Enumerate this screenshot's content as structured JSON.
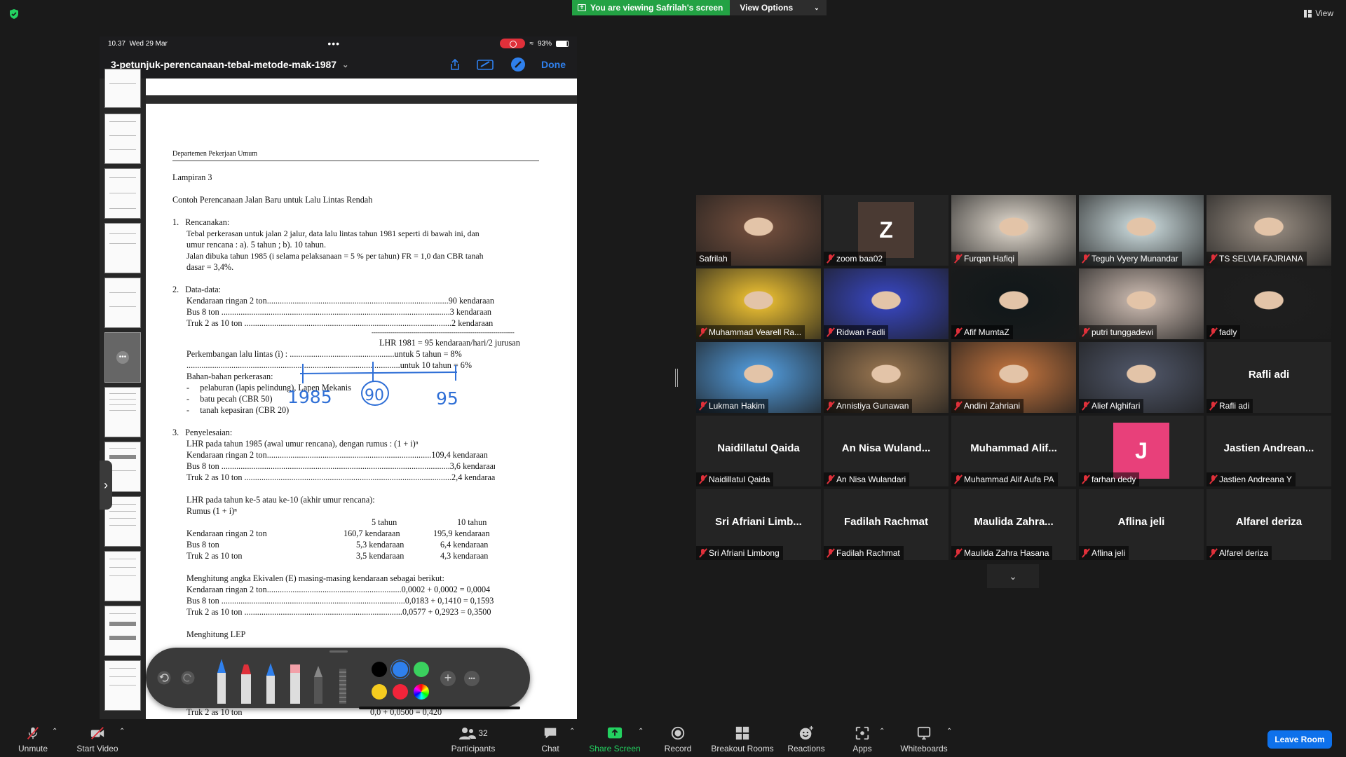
{
  "banner": {
    "share_text": "You are viewing Safrilah's screen",
    "view_options": "View Options"
  },
  "top_right": {
    "view_label": "View"
  },
  "ipad": {
    "time": "10.37",
    "date": "Wed 29 Mar",
    "battery": "93%",
    "doc_title": "3-petunjuk-perencanaan-tebal-metode-mak-1987",
    "done_label": "Done"
  },
  "document": {
    "header": "Departemen Pekerjaan Umum",
    "lines": [
      "Lampiran 3",
      "Contoh Perencanaan Jalan Baru untuk Lalu Lintas Rendah",
      "1.   Rencanakan:",
      "Tebal perkerasan untuk jalan 2 jalur, data lalu lintas tahun 1981 seperti di bawah ini, dan",
      "umur rencana : a). 5 tahun ; b). 10 tahun.",
      "Jalan dibuka tahun 1985 (i selama pelaksanaan = 5 % per tahun) FR = 1,0 dan CBR tanah",
      "dasar = 3,4%.",
      "2.   Data-data:",
      "Kendaraan ringan 2 ton.....................................................................................90 kendaraan",
      "Bus 8 ton ...........................................................................................................3 kendaraan",
      "Truk 2 as 10 ton .................................................................................................2 kendaraan",
      "--------------------------------------------------------------------",
      "LHR 1981 = 95 kendaraan/hari/2 jurusan",
      "Perkembangan lalu lintas (i) : .................................................untuk 5 tahun = 8%",
      "....................................................................................................untuk 10 tahun = 6%",
      "Bahan-bahan perkerasan:",
      "-     pelaburan (lapis pelindung), Lapen Mekanis",
      "-     batu pecah (CBR 50)",
      "-     tanah kepasiran (CBR 20)",
      "3.   Penyelesaian:",
      "LHR pada tahun 1985 (awal umur rencana), dengan rumus : (1 + i)ⁿ",
      "Kendaraan ringan 2 ton.............................................................................109,4 kendaraan",
      "Bus 8 ton ...........................................................................................................3,6 kendaraan",
      "Truk 2 as 10 ton .................................................................................................2,4 kendaraan",
      "LHR pada tahun ke-5 atau ke-10 (akhir umur rencana):",
      "Rumus (1 + i)ⁿ",
      "5 tahun",
      "10 tahun",
      "Kendaraan ringan 2 ton",
      "160,7 kendaraan",
      "195,9 kendaraan",
      "Bus 8 ton",
      "5,3 kendaraan",
      "6,4 kendaraan",
      "Truk 2 as 10 ton",
      "3,5 kendaraan",
      "4,3 kendaraan",
      "Menghitung angka Ekivalen (E) masing-masing kendaraan sebagai berikut:",
      "Kendaraan ringan 2 ton...............................................................0,0002 + 0,0002 = 0,0004",
      "Bus 8 ton ......................................................................................0,0183 + 0,1410 = 0,1593",
      "Truk 2 as 10 ton ..........................................................................0,0577 + 0,2923 = 0,3500",
      "Menghitung LEP",
      "Truk 2 as 10 ton",
      "0,0 + 0,0500 = 0,420"
    ],
    "ink_labels": [
      "1985",
      "90",
      "95"
    ]
  },
  "participants": [
    {
      "name": "Safrilah",
      "muted": false,
      "active": true,
      "bg": "#6b4a3a"
    },
    {
      "name": "zoom baa02",
      "muted": true,
      "letter": "Z",
      "letter_bg": "#4a3a33"
    },
    {
      "name": "Furqan Hafiqi",
      "muted": true,
      "bg": "#c9c2b8"
    },
    {
      "name": "Teguh Vyery Munandar",
      "muted": true,
      "bg": "#b9c7c9"
    },
    {
      "name": "TS SELVIA FAJRIANA",
      "muted": true,
      "bg": "#8b8177"
    },
    {
      "name": "Muhammad Vearell Ra...",
      "muted": true,
      "bg": "#d8b030"
    },
    {
      "name": "Ridwan Fadli",
      "muted": true,
      "bg": "#3542b0"
    },
    {
      "name": "Afif MumtaZ",
      "muted": true,
      "bg": "#12181a"
    },
    {
      "name": "putri tunggadewi",
      "muted": true,
      "bg": "#b8a9a0"
    },
    {
      "name": "fadly",
      "muted": true,
      "bg": "#1e1e1e"
    },
    {
      "name": "Lukman Hakim",
      "muted": true,
      "bg": "#4d8fc9"
    },
    {
      "name": "Annistiya Gunawan",
      "muted": true,
      "bg": "#8a6b4a"
    },
    {
      "name": "Andini Zahriani",
      "muted": true,
      "bg": "#b06a3a"
    },
    {
      "name": "Alief Alghifari",
      "muted": true,
      "bg": "#4a5060"
    },
    {
      "name": "Rafli adi",
      "muted": true,
      "title": "Rafli adi"
    },
    {
      "name": "Naidillatul Qaida",
      "muted": true,
      "title": "Naidillatul Qaida"
    },
    {
      "name": "An Nisa Wulandari",
      "muted": true,
      "title": "An Nisa Wuland..."
    },
    {
      "name": "Muhammad Alif Aufa PA",
      "muted": true,
      "title": "Muhammad  Alif..."
    },
    {
      "name": "farhan dedy",
      "muted": true,
      "letter": "J",
      "letter_bg": "#e8407a"
    },
    {
      "name": "Jastien Andreana Y",
      "muted": true,
      "title": "Jastien Andrean..."
    },
    {
      "name": "Sri Afriani Limbong",
      "muted": true,
      "title": "Sri Afriani  Limb..."
    },
    {
      "name": "Fadilah Rachmat",
      "muted": true,
      "title": "Fadilah Rachmat"
    },
    {
      "name": "Maulida Zahra Hasana",
      "muted": true,
      "title": "Maulida  Zahra..."
    },
    {
      "name": "Aflina jeli",
      "muted": true,
      "title": "Aflina jeli"
    },
    {
      "name": "Alfarel deriza",
      "muted": true,
      "title": "Alfarel deriza"
    }
  ],
  "toolbar": {
    "unmute": "Unmute",
    "start_video": "Start Video",
    "participants": "Participants",
    "participants_count": "32",
    "chat": "Chat",
    "share_screen": "Share Screen",
    "record": "Record",
    "breakout": "Breakout Rooms",
    "reactions": "Reactions",
    "apps": "Apps",
    "whiteboards": "Whiteboards",
    "leave": "Leave Room"
  },
  "colors": {
    "share_green": "#23a244",
    "leave_blue": "#0e71eb",
    "active_speaker": "#f5d63b",
    "muted_red": "#e0303a"
  }
}
